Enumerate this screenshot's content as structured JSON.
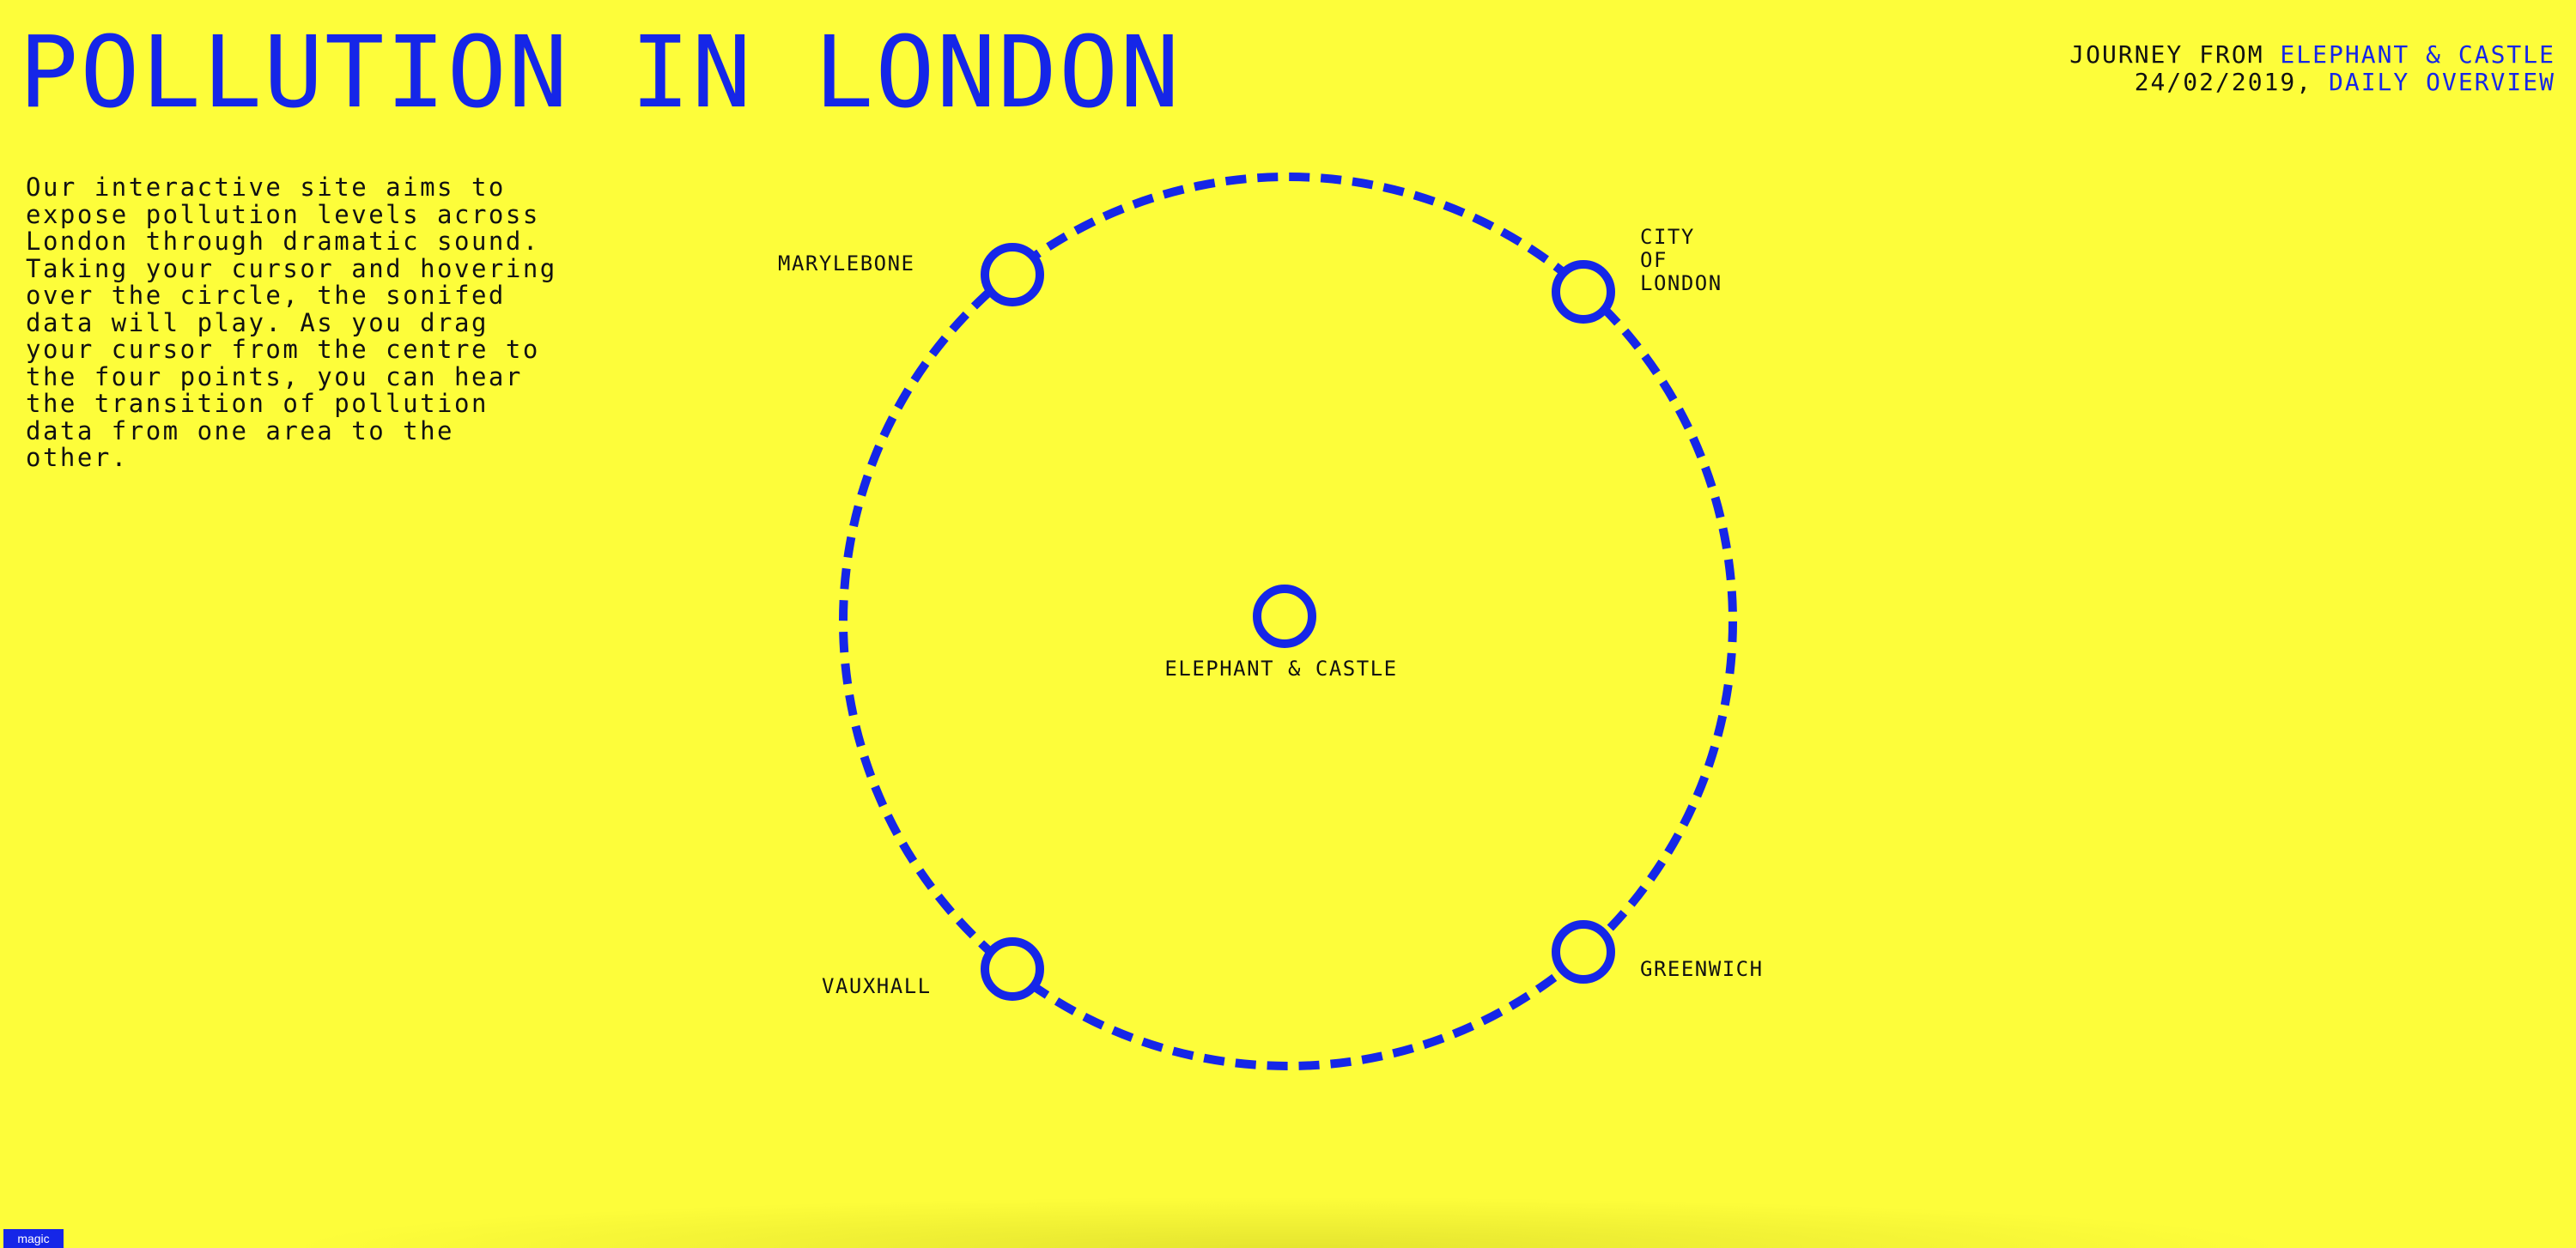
{
  "header": {
    "title": "POLLUTION IN LONDON"
  },
  "intro": {
    "text": "Our interactive site aims to expose pollution levels across London through dramatic sound. Taking your cursor and hovering over the circle, the sonifed data will play. As you drag your cursor from the centre to the four points, you can hear the transition of pollution data from one area to the other."
  },
  "journey": {
    "prefix": "JOURNEY FROM ",
    "origin": "ELEPHANT & CASTLE",
    "date": "24/02/2019, ",
    "view": "DAILY OVERVIEW"
  },
  "map": {
    "center_label": "ELEPHANT & CASTLE",
    "marylebone_label": "MARYLEBONE",
    "city_label_lines": [
      "CITY",
      "OF",
      "LONDON"
    ],
    "vauxhall_label": "VAUXHALL",
    "greenwich_label": "GREENWICH"
  },
  "footer": {
    "magic_label": "magic"
  },
  "colors": {
    "background": "#fdfd3a",
    "accent": "#1526e8",
    "text": "#111111"
  },
  "icons": {
    "node": "circle-ring-icon"
  }
}
